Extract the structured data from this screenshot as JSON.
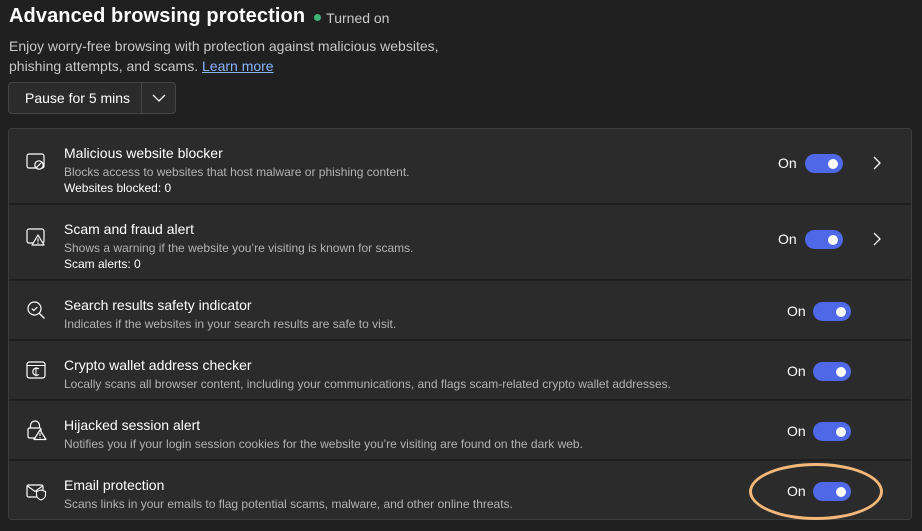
{
  "header": {
    "title": "Advanced browsing protection",
    "status": "Turned on",
    "description": "Enjoy worry-free browsing with protection against malicious websites, phishing attempts, and scams.",
    "learn_more": "Learn more"
  },
  "pause": {
    "label": "Pause for 5 mins"
  },
  "rows": [
    {
      "title": "Malicious website blocker",
      "description": "Blocks access to websites that host malware or phishing content.",
      "count": "Websites blocked: 0",
      "toggle_label": "On",
      "icon": "blocked-site-icon"
    },
    {
      "title": "Scam and fraud alert",
      "description": "Shows a warning if the website you’re visiting is known for scams.",
      "count": "Scam alerts: 0",
      "toggle_label": "On",
      "icon": "warning-window-icon"
    },
    {
      "title": "Search results safety indicator",
      "description": "Indicates if the websites in your search results are safe to visit.",
      "toggle_label": "On",
      "icon": "search-shield-icon"
    },
    {
      "title": "Crypto wallet address checker",
      "description": "Locally scans all browser content, including your communications, and flags scam-related crypto wallet addresses.",
      "toggle_label": "On",
      "icon": "crypto-wallet-icon"
    },
    {
      "title": "Hijacked session alert",
      "description": "Notifies you if your login session cookies for the website you’re visiting are found on the dark web.",
      "toggle_label": "On",
      "icon": "lock-warning-icon"
    },
    {
      "title": "Email protection",
      "description": "Scans links in your emails to flag potential scams, malware, and other online threats.",
      "toggle_label": "On",
      "icon": "email-shield-icon"
    }
  ],
  "colors": {
    "background": "#202020",
    "row_background": "#2b2b2b",
    "toggle_on": "#4f68e8",
    "status_dot": "#3fb37a",
    "link": "#8ab4ff",
    "highlight": "#f4b77a"
  }
}
